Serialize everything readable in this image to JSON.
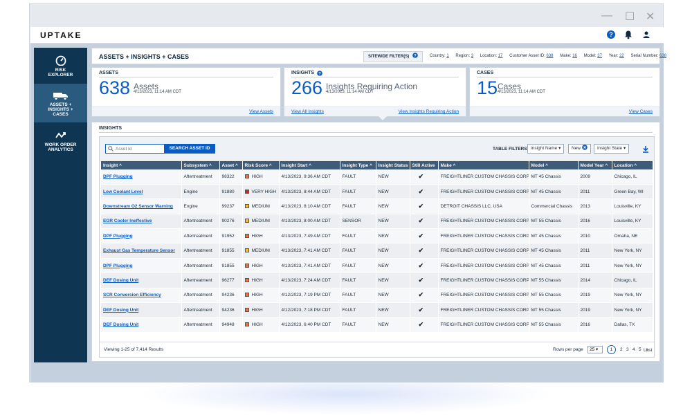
{
  "app": {
    "logo": "UPTAKE",
    "window_controls": {
      "minimize": "—",
      "maximize": "☐",
      "close": "✕"
    }
  },
  "sidebar": {
    "items": [
      {
        "label_1": "RISK",
        "label_2": "EXPLORER",
        "label_3": "",
        "icon": "gauge-icon",
        "active": false
      },
      {
        "label_1": "ASSETS +",
        "label_2": "INSIGHTS +",
        "label_3": "CASES",
        "icon": "truck-icon",
        "active": true
      },
      {
        "label_1": "WORK ORDER",
        "label_2": "ANALYTICS",
        "label_3": "",
        "icon": "trend-icon",
        "active": false
      }
    ]
  },
  "header": {
    "title": "ASSETS + INSIGHTS + CASES",
    "sitewide_label": "SITEWIDE FILTER(S)",
    "filters": [
      {
        "key": "Country:",
        "value": "1"
      },
      {
        "key": "Region:",
        "value": "3"
      },
      {
        "key": "Location:",
        "value": "17"
      },
      {
        "key": "Customer Asset ID:",
        "value": "638"
      },
      {
        "key": "Make:",
        "value": "16"
      },
      {
        "key": "Model:",
        "value": "37"
      },
      {
        "key": "Year:",
        "value": "22"
      },
      {
        "key": "Serial Number:",
        "value": "638"
      }
    ]
  },
  "cards": {
    "assets": {
      "label": "ASSETS",
      "count": "638",
      "unit": "Assets",
      "timestamp": "4/13/2023, 11:14 AM CDT",
      "link": "View Assets"
    },
    "insights": {
      "label": "INSIGHTS",
      "count": "266",
      "unit": "Insights Requiring Action",
      "timestamp": "4/13/2023, 11:14 AM CDT",
      "link_all": "View All Insights",
      "link_action": "View Insights Requiring Action"
    },
    "cases": {
      "label": "CASES",
      "count": "15",
      "unit": "Cases",
      "timestamp": "4/13/2023, 11:14 AM CDT",
      "link": "View Cases"
    }
  },
  "insights_section": {
    "label": "INSIGHTS",
    "search_placeholder": "Asset Id",
    "search_button": "SEARCH ASSET ID",
    "table_filters_label": "TABLE FILTERS",
    "filter_insight_name": "Insight Name",
    "filter_new": "New",
    "filter_insight_state": "Insight State"
  },
  "table": {
    "columns": [
      "Insight ^",
      "Subsystem ^",
      "Asset ^",
      "Risk Score ^",
      "Insight Start ^",
      "Insight Type ^",
      "Insight Status",
      "Still Active",
      "Make ^",
      "Model ^",
      "Model Year ^",
      "Location ^"
    ],
    "risk_colors": {
      "HIGH": "#e8734a",
      "VERY HIGH": "#c62828",
      "MEDIUM": "#f2c029"
    },
    "rows": [
      [
        "DPF Plugging",
        "Aftertreatment",
        "98322",
        "HIGH",
        "4/13/2023, 9:36 AM CDT",
        "FAULT",
        "NEW",
        "✔",
        "FREIGHTLINER CUSTOM CHASSIS CORP.",
        "MT 45 Chassis",
        "2009",
        "Chicago, IL"
      ],
      [
        "Low Coolant Level",
        "Engine",
        "91880",
        "VERY HIGH",
        "4/13/2023, 8:44 AM CDT",
        "FAULT",
        "NEW",
        "✔",
        "FREIGHTLINER CUSTOM CHASSIS CORP.",
        "MT 45 Chassis",
        "2011",
        "Green Bay, WI"
      ],
      [
        "Downstream O2 Sensor Warning",
        "Engine",
        "99237",
        "MEDIUM",
        "4/13/2023, 8:10 AM CDT",
        "FAULT",
        "NEW",
        "✔",
        "DETROIT CHASSIS LLC, USA",
        "Commercial Chassis",
        "2013",
        "Louisville, KY"
      ],
      [
        "EGR Cooler Ineffective",
        "Aftertreatment",
        "90276",
        "MEDIUM",
        "4/13/2023, 8:00 AM CDT",
        "SENSOR",
        "NEW",
        "✔",
        "FREIGHTLINER CUSTOM CHASSIS CORP.",
        "MT 55 Chassis",
        "2016",
        "Louisville, KY"
      ],
      [
        "DPF Plugging",
        "Aftertreatment",
        "91952",
        "HIGH",
        "4/13/2023, 7:49 AM CDT",
        "FAULT",
        "NEW",
        "✔",
        "FREIGHTLINER CUSTOM CHASSIS CORP.",
        "MT 45 Chassis",
        "2010",
        "Omaha, NE"
      ],
      [
        "Exhaust Gas Temperature Sensor",
        "Aftertreatment",
        "91855",
        "MEDIUM",
        "4/13/2023, 7:41 AM CDT",
        "FAULT",
        "NEW",
        "✔",
        "FREIGHTLINER CUSTOM CHASSIS CORP.",
        "MT 45 Chassis",
        "2011",
        "New York, NY"
      ],
      [
        "DPF Plugging",
        "Aftertreatment",
        "91855",
        "HIGH",
        "4/13/2023, 7:41 AM CDT",
        "FAULT",
        "NEW",
        "✔",
        "FREIGHTLINER CUSTOM CHASSIS CORP.",
        "MT 45 Chassis",
        "2011",
        "New York, NY"
      ],
      [
        "DEF Dosing Unit",
        "Aftertreatment",
        "96277",
        "HIGH",
        "4/13/2023, 7:24 AM CDT",
        "FAULT",
        "NEW",
        "✔",
        "FREIGHTLINER CUSTOM CHASSIS CORP.",
        "MT 55 Chassis",
        "2014",
        "Chicago, IL"
      ],
      [
        "SCR Conversion Efficiency",
        "Aftertreatment",
        "94236",
        "HIGH",
        "4/12/2023, 7:19 PM CDT",
        "FAULT",
        "NEW",
        "✔",
        "FREIGHTLINER CUSTOM CHASSIS CORP.",
        "MT 55 Chassis",
        "2019",
        "New York, NY"
      ],
      [
        "DEF Dosing Unit",
        "Aftertreatment",
        "94236",
        "HIGH",
        "4/12/2023, 7:18 PM CDT",
        "FAULT",
        "NEW",
        "✔",
        "FREIGHTLINER CUSTOM CHASSIS CORP.",
        "MT 55 Chassis",
        "2019",
        "New York, NY"
      ],
      [
        "DEF Dosing Unit",
        "Aftertreatment",
        "94948",
        "HIGH",
        "4/12/2023, 6:40 PM CDT",
        "FAULT",
        "NEW",
        "✔",
        "FREIGHTLINER CUSTOM CHASSIS CORP.",
        "MT 55 Chassis",
        "2016",
        "Dallas, TX"
      ]
    ]
  },
  "pager": {
    "viewing": "Viewing 1-25 of 7,414 Results",
    "rows_per_page_label": "Rows per page",
    "rows_per_page": "25 ▾",
    "pages": [
      "1",
      "2",
      "3",
      "4",
      "5"
    ],
    "next": ">",
    "last": "Last"
  }
}
